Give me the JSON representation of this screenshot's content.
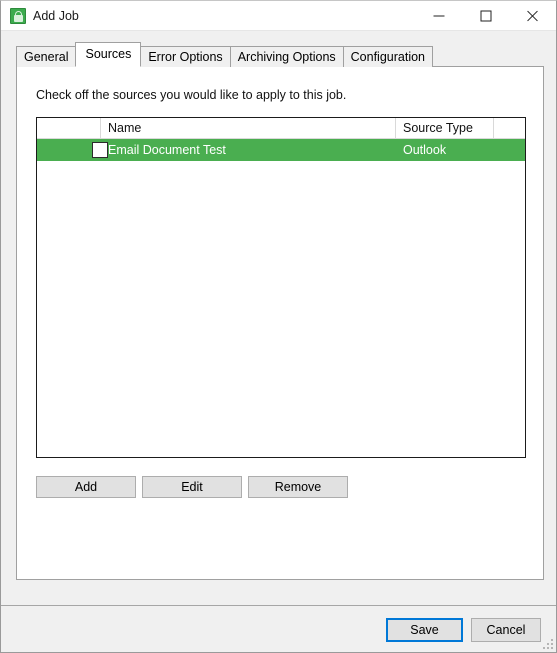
{
  "window": {
    "title": "Add Job",
    "icon": "green-lock-app-icon",
    "caption_buttons": {
      "minimize": "minimize-icon",
      "maximize": "maximize-icon",
      "close": "close-icon"
    }
  },
  "tabs": [
    {
      "label": "General",
      "active": false
    },
    {
      "label": "Sources",
      "active": true
    },
    {
      "label": "Error Options",
      "active": false
    },
    {
      "label": "Archiving Options",
      "active": false
    },
    {
      "label": "Configuration",
      "active": false
    }
  ],
  "panel": {
    "instruction": "Check off the sources you would like to apply to this job."
  },
  "list": {
    "columns": [
      {
        "key": "check",
        "label": ""
      },
      {
        "key": "name",
        "label": "Name"
      },
      {
        "key": "type",
        "label": "Source Type"
      },
      {
        "key": "last",
        "label": ""
      }
    ],
    "rows": [
      {
        "checked": false,
        "name": "Email Document Test",
        "source_type": "Outlook",
        "selected": true
      }
    ]
  },
  "list_buttons": {
    "add": "Add",
    "edit": "Edit",
    "remove": "Remove"
  },
  "footer": {
    "save": "Save",
    "cancel": "Cancel"
  },
  "colors": {
    "selection_green": "#4aae50",
    "accent_blue": "#0078d7",
    "window_bg": "#f0f0f0",
    "panel_bg": "#ffffff",
    "button_face": "#e1e1e1"
  }
}
